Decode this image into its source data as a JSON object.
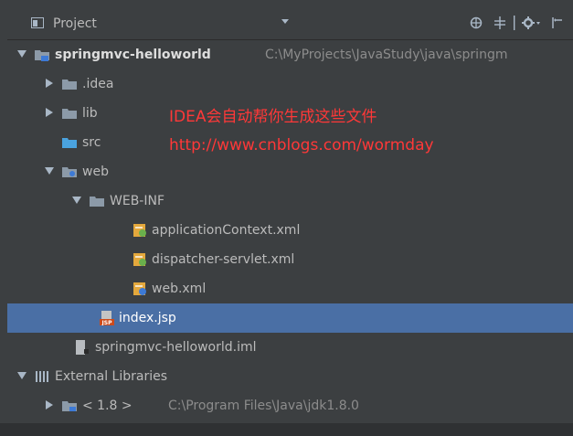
{
  "header": {
    "title": "Project",
    "icons": [
      "crosshair-icon",
      "collapse-icon",
      "gear-icon",
      "hide-icon"
    ]
  },
  "tree": [
    {
      "label": "springmvc-helloworld",
      "path": "C:\\MyProjects\\JavaStudy\\java\\springm",
      "icon": "module-folder-icon",
      "expanded": true
    },
    {
      "label": ".idea",
      "icon": "folder-icon",
      "expanded": false
    },
    {
      "label": "lib",
      "icon": "folder-icon",
      "expanded": false
    },
    {
      "label": "src",
      "icon": "source-folder-icon"
    },
    {
      "label": "web",
      "icon": "web-folder-icon",
      "expanded": true
    },
    {
      "label": "WEB-INF",
      "icon": "folder-icon",
      "expanded": true
    },
    {
      "label": "applicationContext.xml",
      "icon": "spring-xml-icon"
    },
    {
      "label": "dispatcher-servlet.xml",
      "icon": "spring-xml-icon"
    },
    {
      "label": "web.xml",
      "icon": "web-xml-icon"
    },
    {
      "label": "index.jsp",
      "icon": "jsp-icon",
      "selected": true
    },
    {
      "label": "springmvc-helloworld.iml",
      "icon": "iml-icon"
    },
    {
      "label": "External Libraries",
      "icon": "libraries-icon",
      "expanded": true
    },
    {
      "label": "< 1.8 >",
      "path": "C:\\Program Files\\Java\\jdk1.8.0",
      "icon": "jdk-icon",
      "expanded": false
    }
  ],
  "annotations": {
    "line1": "IDEA会自动帮你生成这些文件",
    "line2": "http://www.cnblogs.com/wormday"
  },
  "colors": {
    "background": "#3c3f41",
    "selection": "#4a6fa5",
    "annotation": "#ff3838",
    "text": "#bbbbbb",
    "path": "#8c8c8c"
  }
}
